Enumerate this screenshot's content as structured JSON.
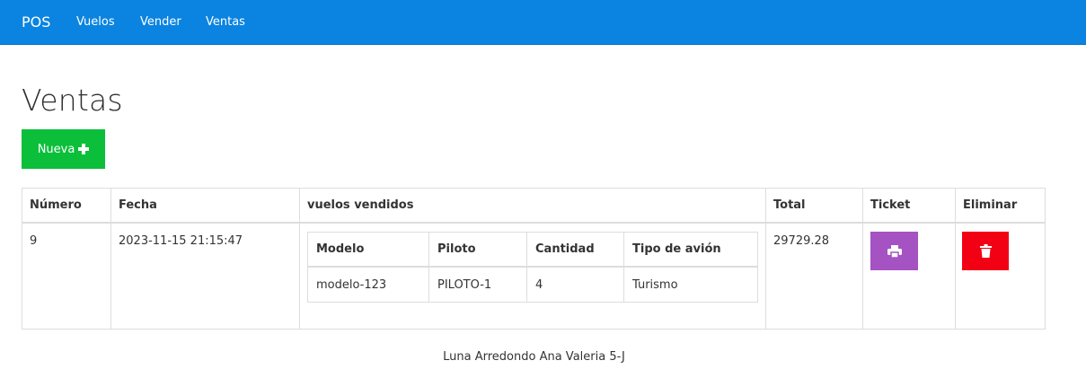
{
  "nav": {
    "brand": "POS",
    "links": [
      "Vuelos",
      "Vender",
      "Ventas"
    ],
    "bg_color": "#0a84e0"
  },
  "page": {
    "title": "Ventas",
    "new_button_label": "Nueva",
    "new_button_icon": "plus-icon",
    "new_button_color": "#0bbf3a"
  },
  "table": {
    "headers": {
      "numero": "Número",
      "fecha": "Fecha",
      "vuelos": "vuelos vendidos",
      "total": "Total",
      "ticket": "Ticket",
      "eliminar": "Eliminar"
    },
    "rows": [
      {
        "numero": "9",
        "fecha": "2023-11-15 21:15:47",
        "total": "29729.28",
        "ticket_icon": "print-icon",
        "ticket_color": "#a552c2",
        "delete_icon": "trash-icon",
        "delete_color": "#f20014",
        "vuelos": {
          "headers": {
            "modelo": "Modelo",
            "piloto": "Piloto",
            "cantidad": "Cantidad",
            "tipo": "Tipo de avión"
          },
          "items": [
            {
              "modelo": "modelo-123",
              "piloto": "PILOTO-1",
              "cantidad": "4",
              "tipo": "Turismo"
            }
          ]
        }
      }
    ]
  },
  "footer": {
    "text": "Luna Arredondo Ana Valeria 5-J"
  }
}
